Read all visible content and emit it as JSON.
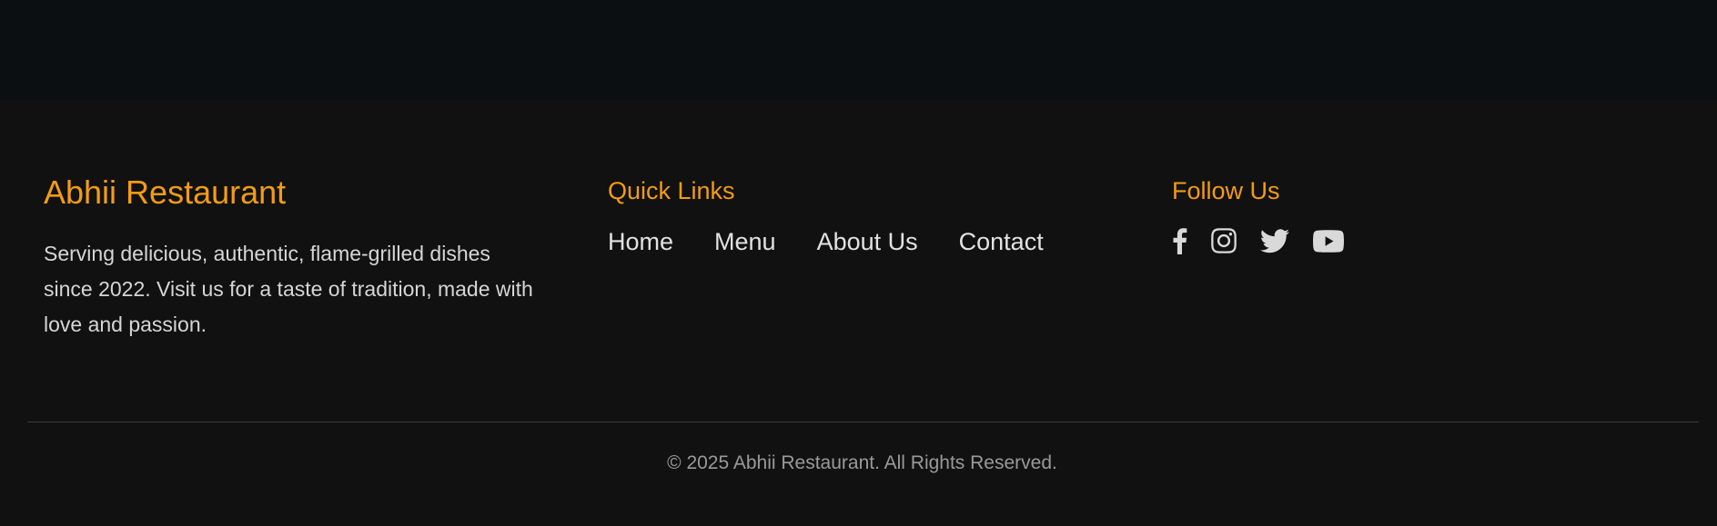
{
  "brand": {
    "title": "Abhii Restaurant",
    "description": "Serving delicious, authentic, flame-grilled dishes since 2022. Visit us for a taste of tradition, made with love and passion."
  },
  "quick_links": {
    "heading": "Quick Links",
    "items": [
      {
        "label": "Home"
      },
      {
        "label": "Menu"
      },
      {
        "label": "About Us"
      },
      {
        "label": "Contact"
      }
    ]
  },
  "follow": {
    "heading": "Follow Us",
    "icons": [
      "facebook-icon",
      "instagram-icon",
      "twitter-icon",
      "youtube-icon"
    ]
  },
  "copyright": "© 2025 Abhii Restaurant. All Rights Reserved.",
  "colors": {
    "accent": "#f39c12",
    "background": "#111111",
    "top_band": "#0b0f11",
    "text": "#d6d6d6",
    "muted": "#9a9a9a"
  }
}
